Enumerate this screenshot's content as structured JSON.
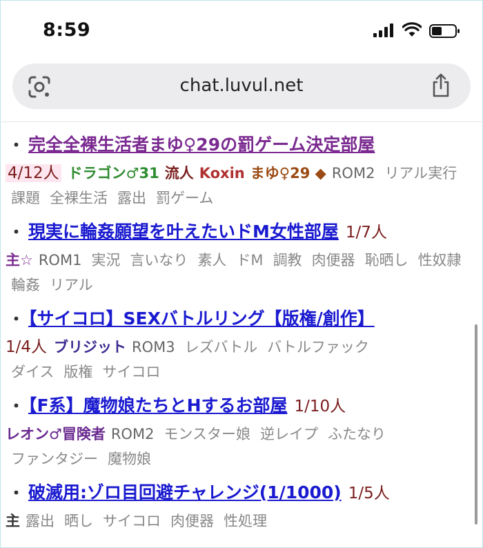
{
  "status_bar": {
    "time": "8:59"
  },
  "browser": {
    "url": "chat.luvul.net"
  },
  "rooms": [
    {
      "bullet": "・",
      "title": "完全全裸生活者まゆ♀29の罰ゲーム決定部屋",
      "count": "4/12人",
      "users": [
        {
          "name": "ドラゴン♂31",
          "color": "#2e8b2e"
        },
        {
          "name": "流人",
          "color": "#7a1d1d"
        },
        {
          "name": "Koxin",
          "color": "#b03030"
        },
        {
          "name": "まゆ♀29 ◆",
          "color": "#9a4a12"
        }
      ],
      "tags": [
        "ROM2",
        "リアル実行",
        "課題",
        "全裸生活",
        "露出",
        "罰ゲーム"
      ]
    },
    {
      "bullet": "・",
      "title": "現実に輪姦願望を叶えたいドM女性部屋",
      "count": "1/7人",
      "users": [
        {
          "name": "主☆",
          "color": "#7a2a90"
        }
      ],
      "tags": [
        "ROM1",
        "実況",
        "言いなり",
        "素人",
        "ドM",
        "調教",
        "肉便器",
        "恥晒し",
        "性奴隷",
        "輪姦",
        "リアル"
      ]
    },
    {
      "bullet": "・",
      "title": "【サイコロ】SEXバトルリング【版権/創作】",
      "count": "1/4人",
      "users": [
        {
          "name": "ブリジット",
          "color": "#3a2a90"
        }
      ],
      "tags": [
        "ROM3",
        "レズバトル",
        "バトルファック",
        "ダイス",
        "版権",
        "サイコロ"
      ]
    },
    {
      "bullet": "・",
      "title": "【F系】魔物娘たちとHするお部屋",
      "count": "1/10人",
      "users": [
        {
          "name": "レオン♂冒険者",
          "color": "#6a2a90"
        }
      ],
      "tags": [
        "ROM2",
        "モンスター娘",
        "逆レイプ",
        "ふたなり",
        "ファンタジー",
        "魔物娘"
      ]
    },
    {
      "bullet": "・",
      "title": "破滅用:ゾロ目回避チャレンジ(1/1000)",
      "count": "1/5人",
      "users": [
        {
          "name": "主",
          "color": "#333333"
        }
      ],
      "tags": [
        "露出",
        "晒し",
        "サイコロ",
        "肉便器",
        "性処理"
      ]
    }
  ]
}
